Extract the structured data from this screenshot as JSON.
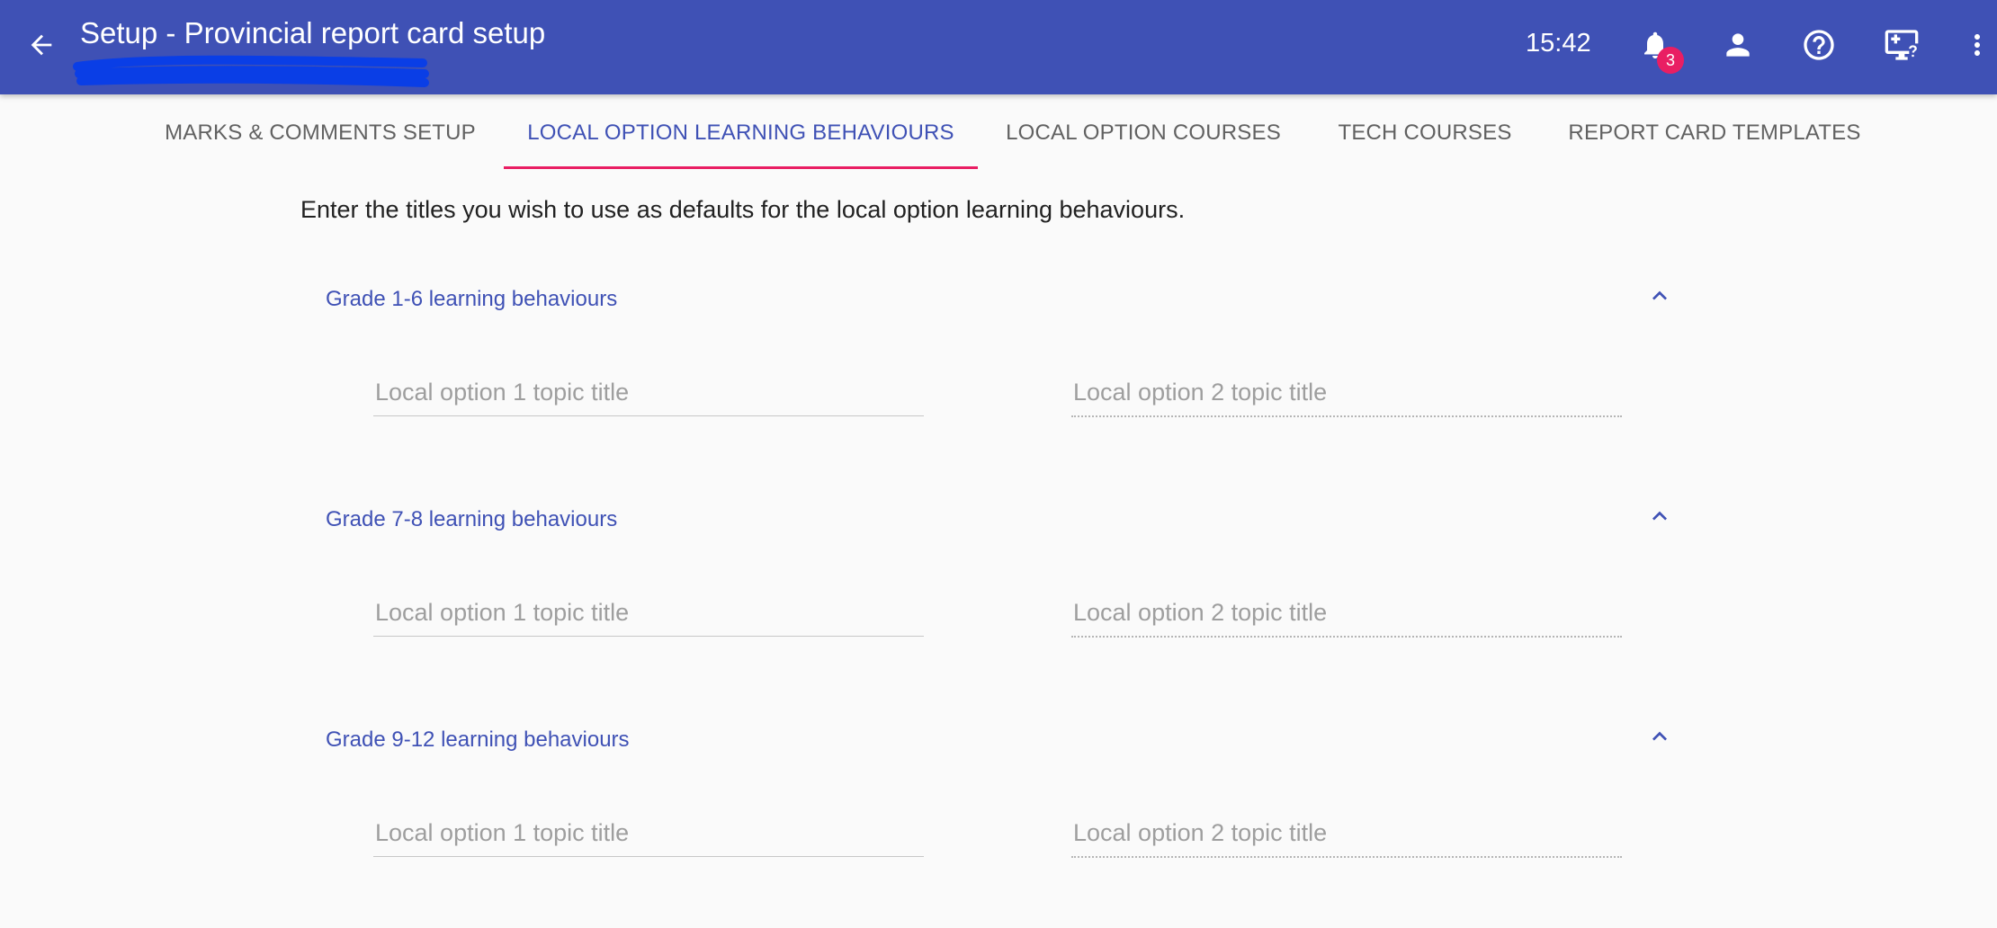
{
  "header": {
    "title": "Setup - Provincial report card setup",
    "clock": "15:42",
    "notification_count": "3",
    "icons": [
      "back-arrow-icon",
      "bell-icon",
      "person-icon",
      "help-circle-icon",
      "monitor-plus-help-icon",
      "more-vert-icon"
    ]
  },
  "tabs": [
    {
      "label": "MARKS & COMMENTS SETUP",
      "active": false
    },
    {
      "label": "LOCAL OPTION LEARNING BEHAVIOURS",
      "active": true
    },
    {
      "label": "LOCAL OPTION COURSES",
      "active": false
    },
    {
      "label": "TECH COURSES",
      "active": false
    },
    {
      "label": "REPORT CARD TEMPLATES",
      "active": false
    }
  ],
  "intro": "Enter the titles you wish to use as defaults for the local option learning behaviours.",
  "sections": [
    {
      "title": "Grade 1-6 learning behaviours",
      "field1_placeholder": "Local option 1 topic title",
      "field2_placeholder": "Local option 2 topic title"
    },
    {
      "title": "Grade 7-8 learning behaviours",
      "field1_placeholder": "Local option 1 topic title",
      "field2_placeholder": "Local option 2 topic title"
    },
    {
      "title": "Grade 9-12 learning behaviours",
      "field1_placeholder": "Local option 1 topic title",
      "field2_placeholder": "Local option 2 topic title"
    }
  ],
  "colors": {
    "primary": "#3f51b5",
    "accent": "#e91e63",
    "background": "#fafafa",
    "redaction": "#0a3ee6"
  }
}
